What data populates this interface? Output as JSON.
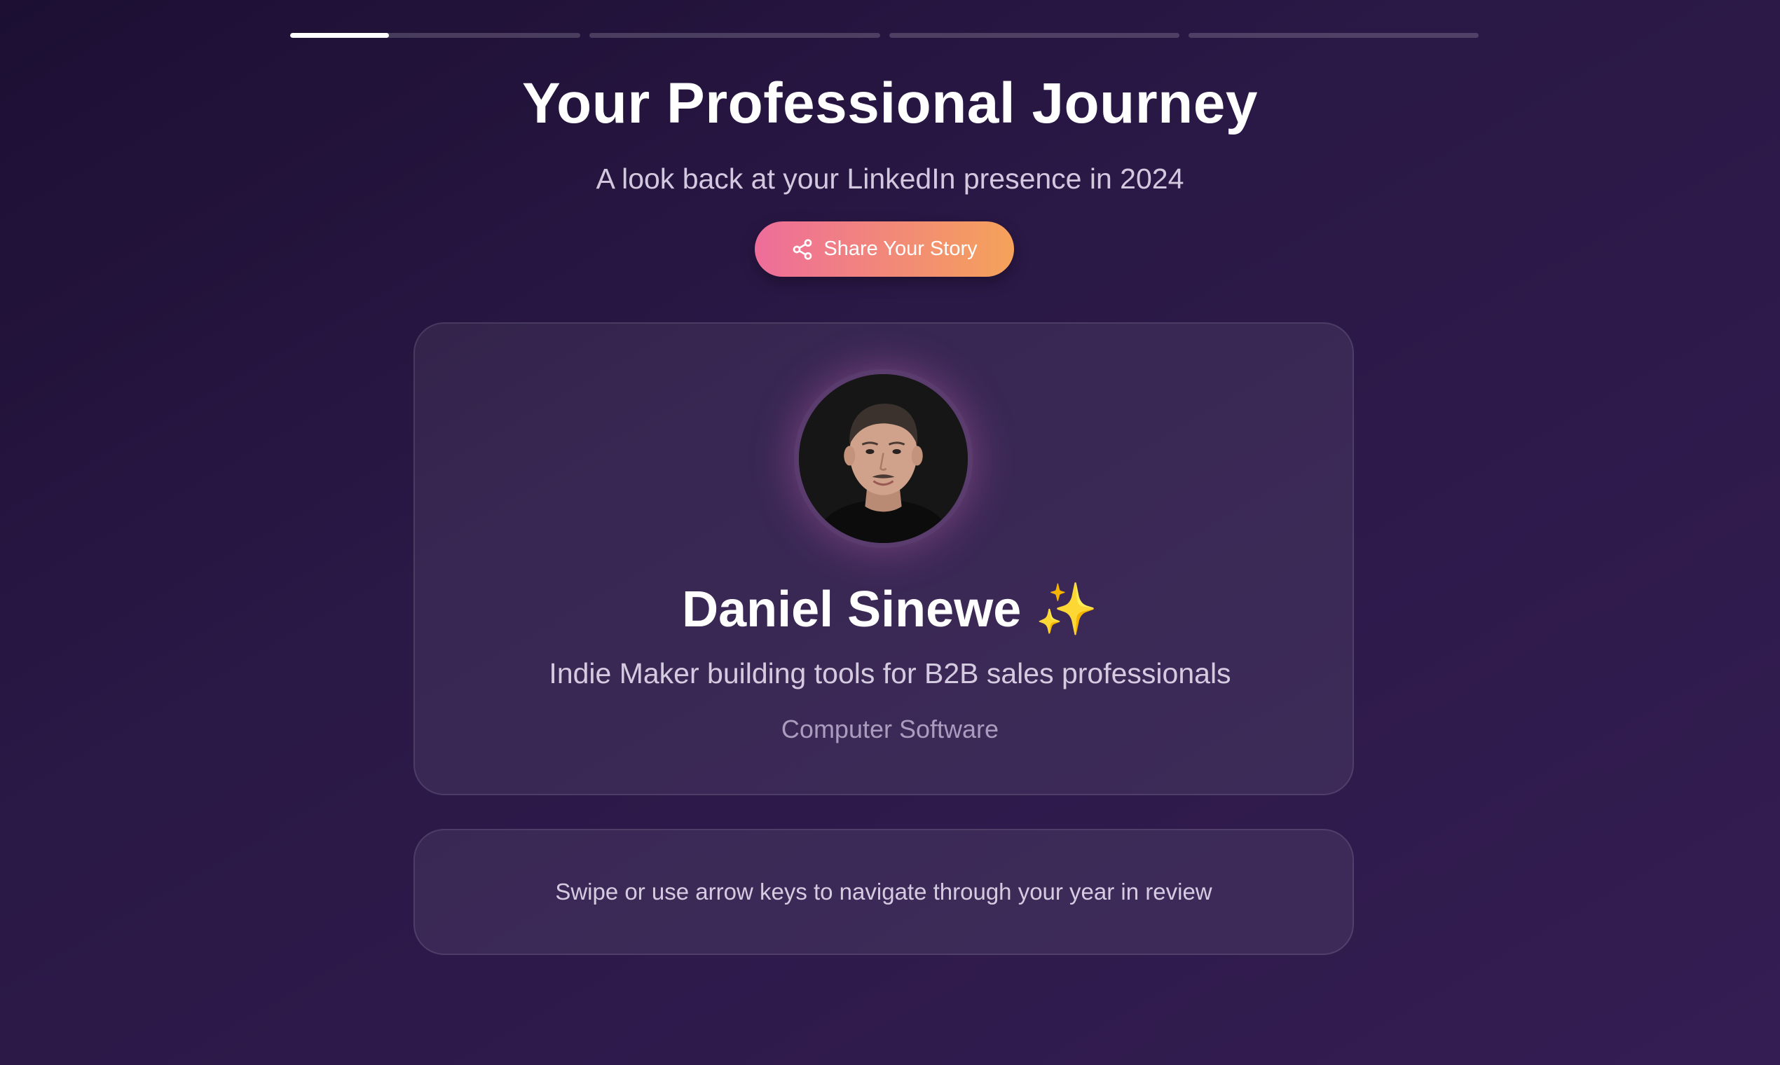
{
  "progress": {
    "segments": 4,
    "current": 1,
    "current_fill": 0.34
  },
  "header": {
    "title": "Your Professional Journey",
    "subtitle": "A look back at your LinkedIn presence in 2024"
  },
  "share": {
    "label": "Share Your Story",
    "icon": "share-icon"
  },
  "profile": {
    "name": "Daniel Sinewe",
    "emoji": "✨",
    "headline": "Indie Maker building tools for B2B sales professionals",
    "industry": "Computer Software",
    "avatar_icon": "profile-photo"
  },
  "navigation": {
    "hint": "Swipe or use arrow keys to navigate through your year in review"
  },
  "colors": {
    "background_start": "#1c0f33",
    "background_end": "#341d52",
    "button_gradient_start": "#ee6d9a",
    "button_gradient_end": "#f5a25a",
    "sparkle": "#f7d35c"
  }
}
